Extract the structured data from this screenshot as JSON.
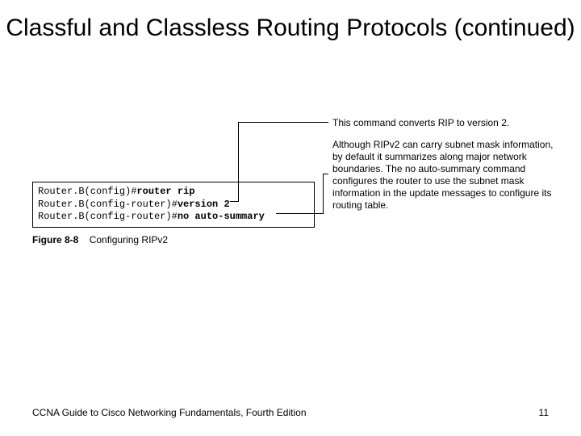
{
  "title": "Classful and Classless Routing Protocols (continued)",
  "code": {
    "l1a": "Router.B(config)#",
    "l1b": "router rip",
    "l2a": "Router.B(config-router)#",
    "l2b": "version 2",
    "l3a": "Router.B(config-router)#",
    "l3b": "no auto-summary"
  },
  "note1": "This command converts RIP to version 2.",
  "note2": "Although RIPv2 can carry subnet mask information, by default it summarizes along major network boundaries. The no auto-summary command configures the router to use the subnet mask information in the update messages to configure its routing table.",
  "figure": {
    "num": "Figure 8-8",
    "caption": "Configuring RIPv2"
  },
  "footer": {
    "left": "CCNA Guide to Cisco Networking Fundamentals, Fourth Edition",
    "right": "11"
  }
}
